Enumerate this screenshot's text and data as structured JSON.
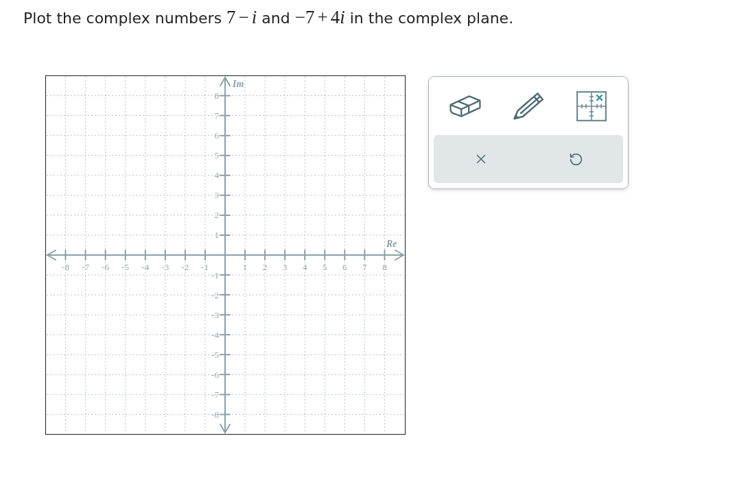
{
  "question": {
    "parts": [
      {
        "kind": "text",
        "text": "Plot the complex numbers"
      },
      {
        "kind": "math",
        "tokens": [
          {
            "kind": "number",
            "text": "7"
          },
          {
            "kind": "binary_operator",
            "text": "−"
          },
          {
            "kind": "variable",
            "text": "i"
          }
        ]
      },
      {
        "kind": "text",
        "text": "and"
      },
      {
        "kind": "math",
        "tokens": [
          {
            "kind": "unary_operator",
            "text": "−"
          },
          {
            "kind": "number",
            "text": "7"
          },
          {
            "kind": "binary_operator",
            "text": "+"
          },
          {
            "kind": "number",
            "text": "4"
          },
          {
            "kind": "variable",
            "text": "i"
          }
        ]
      },
      {
        "kind": "text",
        "text": "in the complex plane."
      }
    ]
  },
  "plane": {
    "x_axis_label": "Re",
    "y_axis_label": "Im",
    "x_tick_labels": [
      "-8",
      "-7",
      "-6",
      "-5",
      "-4",
      "-3",
      "-2",
      "-1",
      "1",
      "2",
      "3",
      "4",
      "5",
      "6",
      "7",
      "8"
    ],
    "y_tick_labels": [
      "8",
      "7",
      "6",
      "5",
      "4",
      "3",
      "2",
      "1",
      "-1",
      "-2",
      "-3",
      "-4",
      "-5",
      "-6",
      "-7",
      "-8"
    ]
  }
}
